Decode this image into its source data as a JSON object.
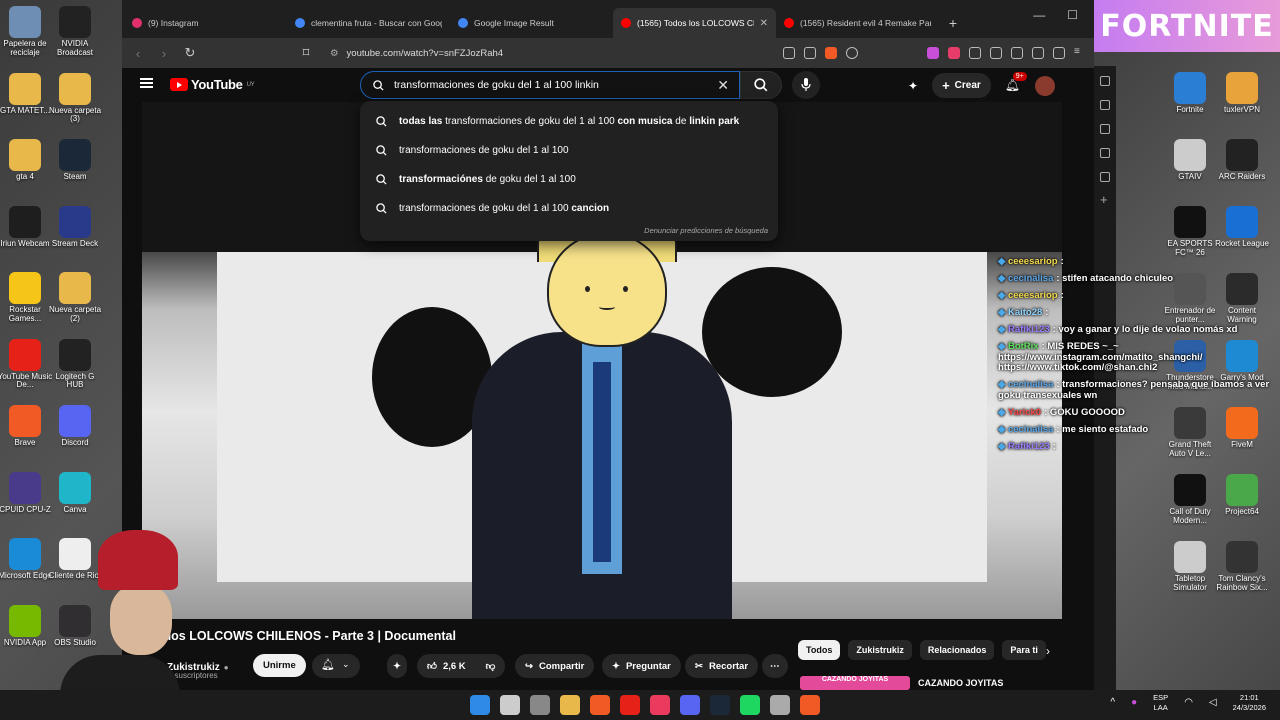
{
  "desktop": {
    "left_icons": [
      {
        "label": "Papelera de reciclaje",
        "color": "#6e8fb3"
      },
      {
        "label": "NVIDIA Broadcast",
        "color": "#222222"
      },
      {
        "label": "GTA MATET...",
        "color": "#e8b84a"
      },
      {
        "label": "Nueva carpeta (3)",
        "color": "#e8b84a"
      },
      {
        "label": "gta 4",
        "color": "#e8b84a"
      },
      {
        "label": "Steam",
        "color": "#1b2838"
      },
      {
        "label": "Iriun Webcam",
        "color": "#1e1e1e"
      },
      {
        "label": "Stream Deck",
        "color": "#2a3a8a"
      },
      {
        "label": "Rockstar Games...",
        "color": "#f5c518"
      },
      {
        "label": "Nueva carpeta (2)",
        "color": "#e8b84a"
      },
      {
        "label": "YouTube Music De...",
        "color": "#e62117"
      },
      {
        "label": "Logitech G HUB",
        "color": "#222222"
      },
      {
        "label": "Brave",
        "color": "#f15a24"
      },
      {
        "label": "Discord",
        "color": "#5865f2"
      },
      {
        "label": "CPUID CPU-Z",
        "color": "#4a3a8a"
      },
      {
        "label": "Canva",
        "color": "#1fb6c9"
      },
      {
        "label": "Microsoft Edge",
        "color": "#1a8bd6"
      },
      {
        "label": "Cliente de Riot",
        "color": "#eeeeee"
      },
      {
        "label": "NVIDIA App",
        "color": "#76b900"
      },
      {
        "label": "OBS Studio",
        "color": "#302e31"
      }
    ],
    "right_icons": [
      {
        "label": "Fortnite",
        "color": "#2a7fd4"
      },
      {
        "label": "tuxlerVPN",
        "color": "#e8a33a"
      },
      {
        "label": "GTAIV",
        "color": "#cccccc"
      },
      {
        "label": "ARC Raiders",
        "color": "#222222"
      },
      {
        "label": "EA SPORTS FC™ 26",
        "color": "#111111"
      },
      {
        "label": "Rocket League",
        "color": "#1a6fd4"
      },
      {
        "label": "Entrenador de punter...",
        "color": "#555555"
      },
      {
        "label": "Content Warning",
        "color": "#2b2b2b"
      },
      {
        "label": "Thunderstore Mod Mana...",
        "color": "#2b5fa6"
      },
      {
        "label": "Garry's Mod",
        "color": "#1f8ad4"
      },
      {
        "label": "Grand Theft Auto V Le...",
        "color": "#3a3a3a"
      },
      {
        "label": "FiveM",
        "color": "#f46a1d"
      },
      {
        "label": "Call of Duty Modern...",
        "color": "#111111"
      },
      {
        "label": "Project64",
        "color": "#4aa84a"
      },
      {
        "label": "Tabletop Simulator",
        "color": "#cccccc"
      },
      {
        "label": "Tom Clancy's Rainbow Six...",
        "color": "#333333"
      }
    ]
  },
  "browser": {
    "tabs": [
      {
        "label": "(9) Instagram",
        "color": "#e1306c",
        "active": false
      },
      {
        "label": "clementina fruta - Buscar con Google",
        "color": "#4285f4",
        "active": false
      },
      {
        "label": "Google Image Result",
        "color": "#4285f4",
        "active": false
      },
      {
        "label": "(1565) Todos los LOLCOWS CHIL",
        "color": "#ff0000",
        "active": true
      },
      {
        "label": "(1565) Resident evil 4 Remake Part.2",
        "color": "#ff0000",
        "active": false
      }
    ],
    "new_tab": "+",
    "url": "youtube.com/watch?v=snFZJozRah4"
  },
  "youtube": {
    "logo_text": "YouTube",
    "country": "UY",
    "search_value": "transformaciones de goku del 1 al 100 linkin",
    "suggestions": [
      {
        "parts": [
          [
            "b",
            "todas las"
          ],
          [
            "n",
            " transformaciones de goku del 1 al 100 "
          ],
          [
            "b",
            "con musica"
          ],
          [
            "n",
            " de "
          ],
          [
            "b",
            "linkin park"
          ]
        ]
      },
      {
        "parts": [
          [
            "n",
            "transformaciones de goku del 1 al 100"
          ]
        ]
      },
      {
        "parts": [
          [
            "b",
            "transformaciónes"
          ],
          [
            "n",
            " de goku del 1 al 100"
          ]
        ]
      },
      {
        "parts": [
          [
            "n",
            "transformaciones de goku del 1 al 100 "
          ],
          [
            "b",
            "cancion"
          ]
        ]
      }
    ],
    "report_text": "Denunciar predicciones de búsqueda",
    "create_label": "Crear",
    "notif_count": "9+",
    "video_title": "dos los LOLCOWS CHILENOS - Parte 3 | Documental",
    "channel_name": "Zukistrukiz",
    "subs_text": "K suscriptores",
    "join_label": "Unirme",
    "like_count": "2,6 K",
    "share_label": "Compartir",
    "ask_label": "Preguntar",
    "clip_label": "Recortar",
    "chips": [
      "Todos",
      "Zukistrukiz",
      "Relacionados",
      "Para ti"
    ],
    "reco_title": "CAZANDO JOYITAS",
    "reco_thumb_text": "CAZANDO JOYITAS"
  },
  "chat": [
    {
      "user": "ceeesariop",
      "user_color": "#f2d94e",
      "text": ":"
    },
    {
      "user": "cecinalisa",
      "user_color": "#5aa6e8",
      "text": ": stifen atacando chiculeo"
    },
    {
      "user": "ceeesariop",
      "user_color": "#f2d94e",
      "text": ":"
    },
    {
      "user": "Kaito28",
      "user_color": "#8fd3ff",
      "text": ":"
    },
    {
      "user": "Rafiki123",
      "user_color": "#9b7cff",
      "text": ": voy a ganar y lo dije de volao nomás xd"
    },
    {
      "user": "BotRix",
      "user_color": "#5ee05e",
      "text": ": MIS REDES ~_~ https://www.instagram.com/matito_shangchi/ https://www.tiktok.com/@shan.chi2"
    },
    {
      "user": "cecinalisa",
      "user_color": "#5aa6e8",
      "text": ": transformaciones? pensaba que íbamos a ver goku transexuales wn"
    },
    {
      "user": "Yarick0",
      "user_color": "#ff4a4a",
      "text": ": GOKU GOOOOD"
    },
    {
      "user": "cecinalisa",
      "user_color": "#5aa6e8",
      "text": ": me siento estafado"
    },
    {
      "user": "Rafiki123",
      "user_color": "#9b7cff",
      "text": ":"
    }
  ],
  "overlay": {
    "brand": "FORTNITE"
  },
  "taskbar": {
    "lang": "ESP",
    "lang2": "LAA",
    "time": "21:01",
    "date": "24/3/2026",
    "icons": [
      "#2e8ae6",
      "#cccccc",
      "#888888",
      "#e8b84a",
      "#f15a24",
      "#e62117",
      "#ea3a5e",
      "#5865f2",
      "#1b2838",
      "#1ed760",
      "#aaaaaa",
      "#f15a24"
    ]
  }
}
